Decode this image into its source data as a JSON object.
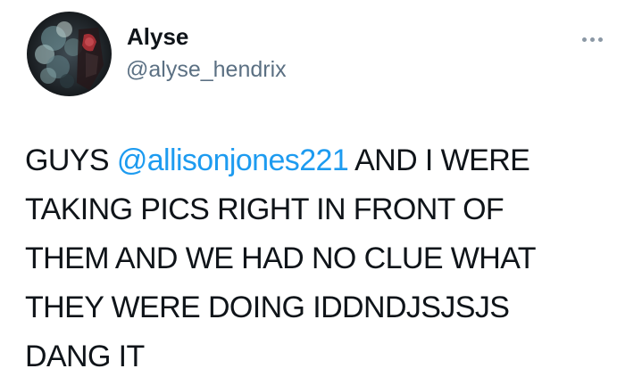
{
  "tweet": {
    "author": {
      "display_name": "Alyse",
      "handle": "@alyse_hendrix"
    },
    "more_icon": "more-horizontal-icon",
    "text": {
      "line1_before": "GUYS ",
      "mention": "@allisonjones221",
      "line1_after": " AND I WERE",
      "line2": "TAKING PICS RIGHT IN FRONT OF",
      "line3": "THEM AND WE HAD NO CLUE WHAT",
      "line4": "THEY WERE DOING IDDNDJSJSJS",
      "line5": "DANG IT"
    }
  },
  "colors": {
    "text": "#0f1419",
    "secondary": "#5b7083",
    "link": "#1d9bf0",
    "icon": "#8b98a5"
  }
}
